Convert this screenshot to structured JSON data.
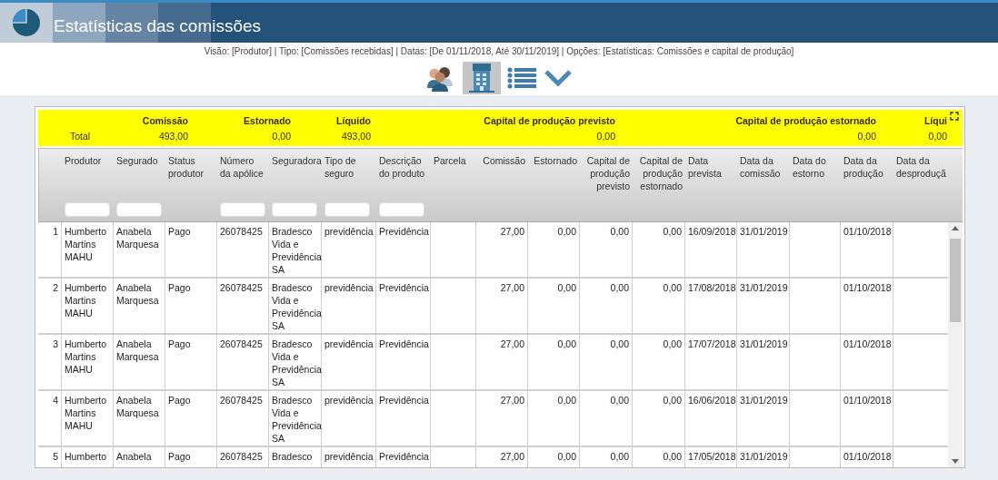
{
  "window": {
    "title": "Estatísticas das comissões"
  },
  "filter_summary": "Visão: [Produtor] | Tipo: [Comissões recebidas] | Datas: [De 01/11/2018, Até 30/11/2019] | Opções: [Estatísticas: Comissões e capital de produção]",
  "view_buttons": [
    {
      "kind": "people",
      "selected": false
    },
    {
      "kind": "building",
      "selected": true
    },
    {
      "kind": "list",
      "selected": false
    },
    {
      "kind": "chevron",
      "selected": false
    }
  ],
  "summary": {
    "columns": [
      "Comissão",
      "Estornado",
      "Líquido",
      "Capital de produção previsto",
      "Capital de produção estornado",
      "Líqui"
    ],
    "rows": [
      {
        "label": "Total",
        "values": [
          "493,00",
          "0,00",
          "493,00",
          "0,00",
          "0,00",
          "0,00"
        ]
      }
    ]
  },
  "table": {
    "columns": [
      {
        "label": "Produtor",
        "kind": "text",
        "filter": true
      },
      {
        "label": "Segurado",
        "kind": "text",
        "filter": true
      },
      {
        "label": "Status produtor",
        "kind": "text",
        "filter": false
      },
      {
        "label": "Número da apólice",
        "kind": "text",
        "filter": true
      },
      {
        "label": "Seguradora",
        "kind": "text",
        "filter": true
      },
      {
        "label": "Tipo de seguro",
        "kind": "text",
        "filter": true
      },
      {
        "label": "Descrição do produto",
        "kind": "text",
        "filter": true
      },
      {
        "label": "Parcela",
        "kind": "text",
        "filter": false
      },
      {
        "label": "Comissão",
        "kind": "number",
        "filter": false
      },
      {
        "label": "Estornado",
        "kind": "number",
        "filter": false
      },
      {
        "label": "Capital de produção previsto",
        "kind": "number",
        "filter": false
      },
      {
        "label": "Capital de produção estornado",
        "kind": "number",
        "filter": false
      },
      {
        "label": "Data prevista",
        "kind": "text",
        "filter": false
      },
      {
        "label": "Data da comissão",
        "kind": "text",
        "filter": false
      },
      {
        "label": "Data do estorno",
        "kind": "text",
        "filter": false
      },
      {
        "label": "Data da produção",
        "kind": "text",
        "filter": false
      },
      {
        "label": "Data da desproduçã",
        "kind": "text",
        "filter": false
      }
    ],
    "rows": [
      {
        "number": "1",
        "cells": [
          "Humberto Martins MAHU",
          "Anabela Marquesa",
          "Pago",
          "26078425",
          "Bradesco Vida e Previdência SA",
          "previdência",
          "Previdência",
          "",
          "27,00",
          "0,00",
          "0,00",
          "0,00",
          "16/09/2018",
          "31/01/2019",
          "",
          "01/10/2018",
          ""
        ]
      },
      {
        "number": "2",
        "cells": [
          "Humberto Martins MAHU",
          "Anabela Marquesa",
          "Pago",
          "26078425",
          "Bradesco Vida e Previdência SA",
          "previdência",
          "Previdência",
          "",
          "27,00",
          "0,00",
          "0,00",
          "0,00",
          "17/08/2018",
          "31/01/2019",
          "",
          "01/10/2018",
          ""
        ]
      },
      {
        "number": "3",
        "cells": [
          "Humberto Martins MAHU",
          "Anabela Marquesa",
          "Pago",
          "26078425",
          "Bradesco Vida e Previdência SA",
          "previdência",
          "Previdência",
          "",
          "27,00",
          "0,00",
          "0,00",
          "0,00",
          "17/07/2018",
          "31/01/2019",
          "",
          "01/10/2018",
          ""
        ]
      },
      {
        "number": "4",
        "cells": [
          "Humberto Martins MAHU",
          "Anabela Marquesa",
          "Pago",
          "26078425",
          "Bradesco Vida e Previdência SA",
          "previdência",
          "Previdência",
          "",
          "27,00",
          "0,00",
          "0,00",
          "0,00",
          "16/06/2018",
          "31/01/2019",
          "",
          "01/10/2018",
          ""
        ]
      },
      {
        "number": "5",
        "cells": [
          "Humberto",
          "Anabela",
          "Pago",
          "26078425",
          "Bradesco",
          "previdência",
          "Previdência",
          "",
          "27,00",
          "0,00",
          "0,00",
          "0,00",
          "17/05/2018",
          "31/01/2019",
          "",
          "01/10/2018",
          ""
        ]
      }
    ]
  }
}
